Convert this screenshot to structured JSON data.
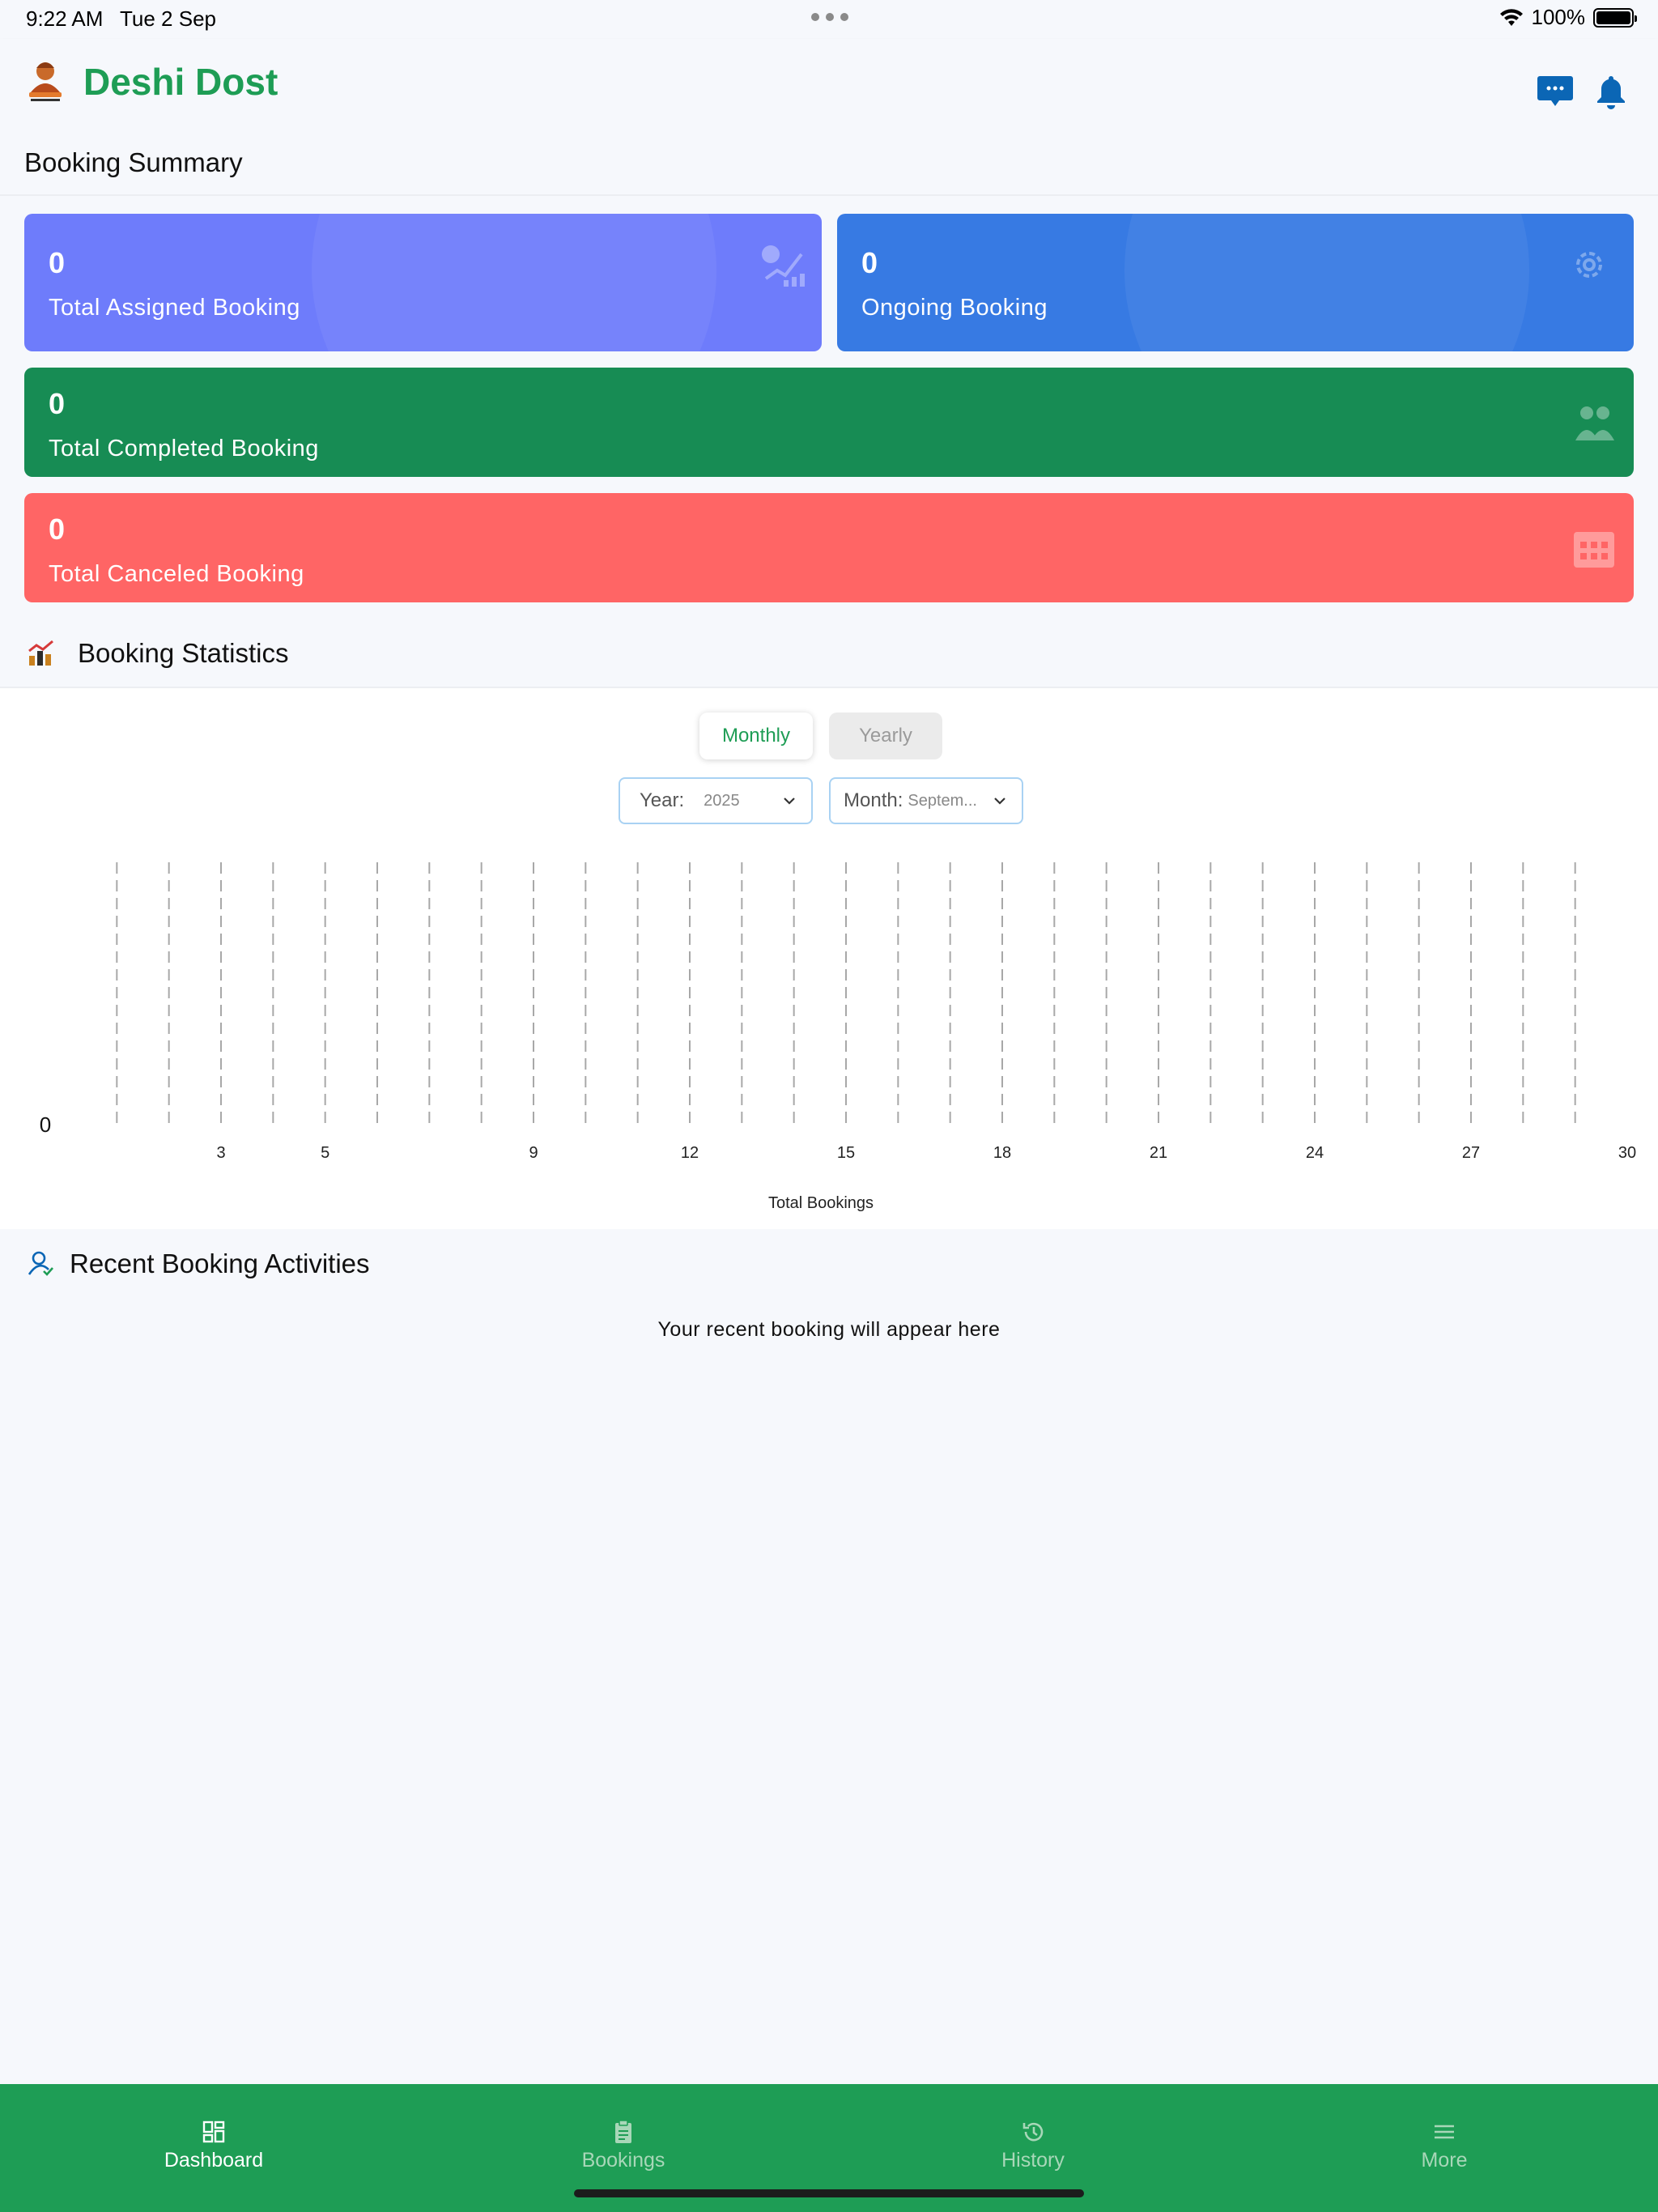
{
  "status_bar": {
    "time": "9:22 AM",
    "date": "Tue 2 Sep",
    "battery": "100%"
  },
  "header": {
    "title": "Deshi Dost"
  },
  "summary": {
    "title": "Booking Summary",
    "cards": [
      {
        "value": "0",
        "label": "Total Assigned Booking",
        "color": "#6e7cfb"
      },
      {
        "value": "0",
        "label": "Ongoing Booking",
        "color": "#377ae3"
      },
      {
        "value": "0",
        "label": "Total Completed Booking",
        "color": "#178c54"
      },
      {
        "value": "0",
        "label": "Total Canceled Booking",
        "color": "#ff6565"
      }
    ]
  },
  "statistics": {
    "title": "Booking Statistics",
    "tabs": {
      "monthly": "Monthly",
      "yearly": "Yearly"
    },
    "year_select": {
      "label": "Year:",
      "value": "2025"
    },
    "month_select": {
      "label": "Month:",
      "value": "Septem..."
    }
  },
  "chart_data": {
    "type": "line",
    "x": [
      1,
      2,
      3,
      4,
      5,
      6,
      7,
      8,
      9,
      10,
      11,
      12,
      13,
      14,
      15,
      16,
      17,
      18,
      19,
      20,
      21,
      22,
      23,
      24,
      25,
      26,
      27,
      28,
      29,
      30
    ],
    "series": [
      {
        "values": [
          0,
          0,
          0,
          0,
          0,
          0,
          0,
          0,
          0,
          0,
          0,
          0,
          0,
          0,
          0,
          0,
          0,
          0,
          0,
          0,
          0,
          0,
          0,
          0,
          0,
          0,
          0,
          0,
          0,
          0
        ]
      }
    ],
    "xtick_labels": [
      "3",
      "5",
      "9",
      "12",
      "15",
      "18",
      "21",
      "24",
      "27",
      "30"
    ],
    "xtick_values": [
      3,
      5,
      9,
      12,
      15,
      18,
      21,
      24,
      27,
      30
    ],
    "ytick_labels": [
      "0"
    ],
    "xlabel": "Total Bookings",
    "ylabel": "",
    "title": "",
    "xlim": [
      0,
      30
    ],
    "ylim": [
      0,
      0
    ],
    "grid": "vertical-dashed",
    "line_gradient": [
      "#ff6b81",
      "#3d4fa8"
    ]
  },
  "recent": {
    "title": "Recent Booking Activities",
    "empty_message": "Your recent booking will appear here"
  },
  "bottom_nav": [
    {
      "label": "Dashboard",
      "icon": "dashboard-icon",
      "active": true
    },
    {
      "label": "Bookings",
      "icon": "clipboard-icon",
      "active": false
    },
    {
      "label": "History",
      "icon": "history-icon",
      "active": false
    },
    {
      "label": "More",
      "icon": "menu-icon",
      "active": false
    }
  ]
}
